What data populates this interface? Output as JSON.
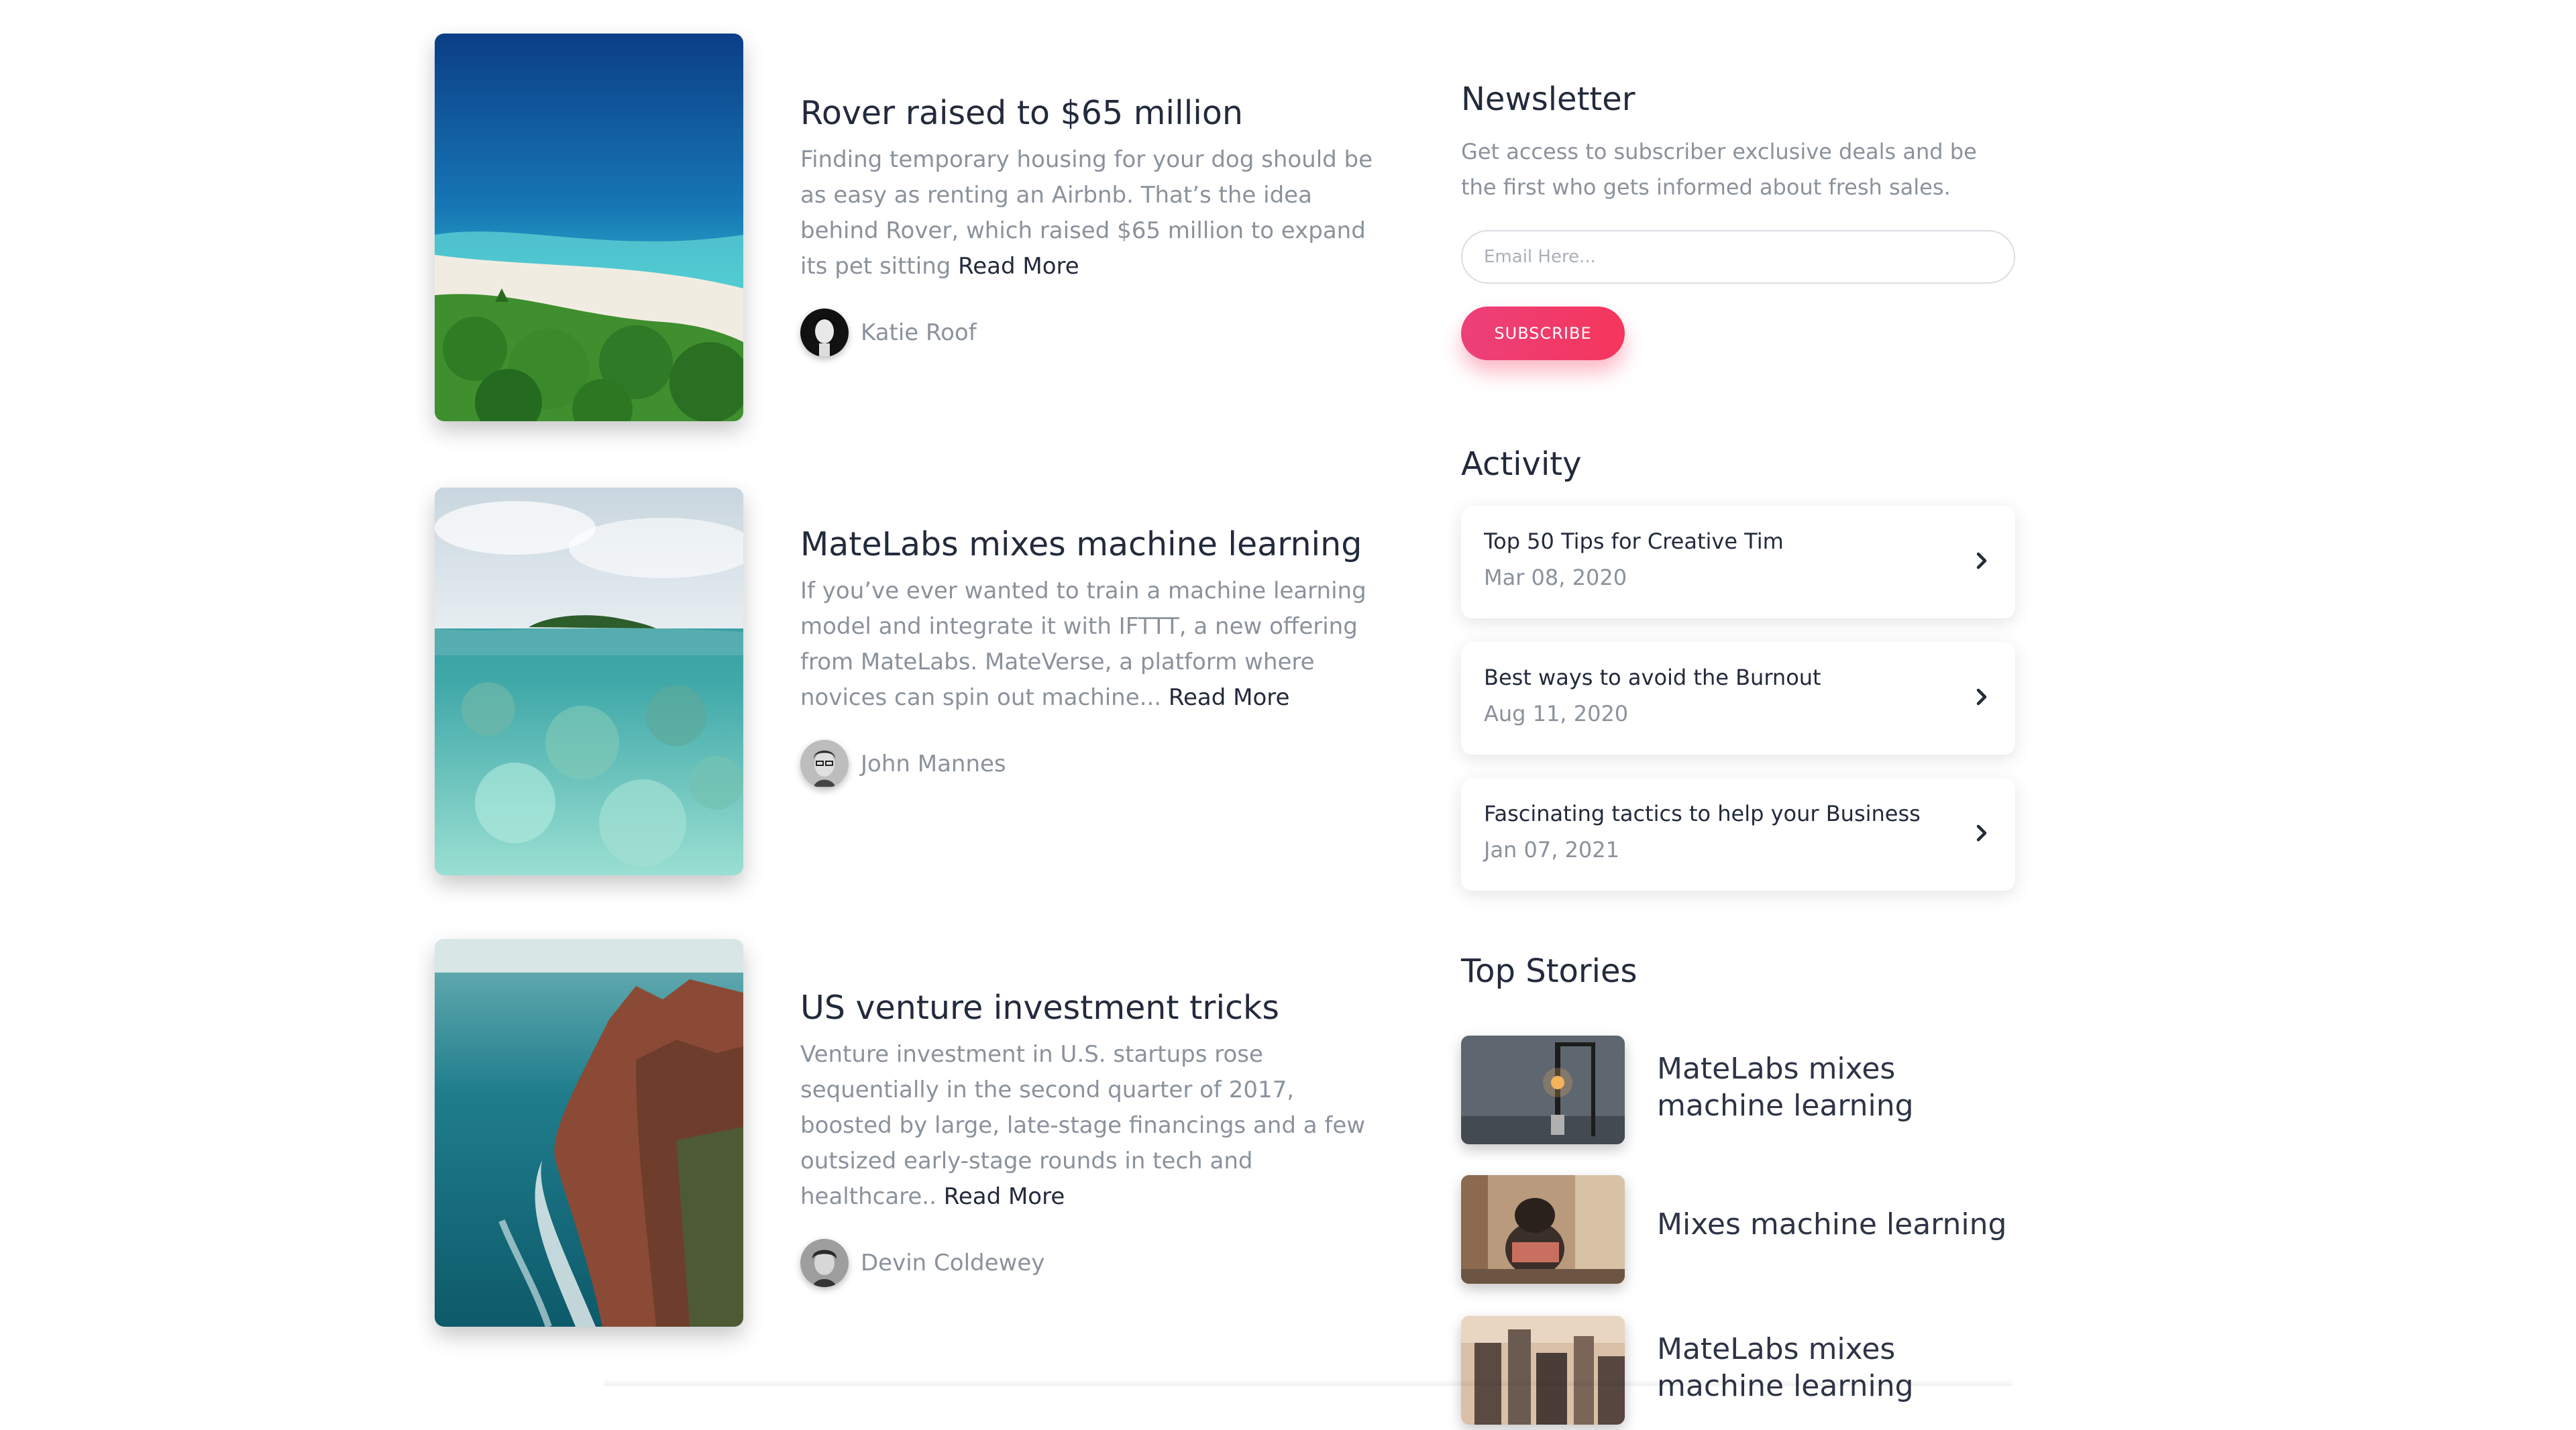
{
  "articles": [
    {
      "title": "Rover raised to $65 million",
      "excerpt": "Finding temporary housing for your dog should be as easy as renting an Airbnb. That’s the idea behind Rover, which raised $65 million to expand its pet sitting ",
      "read_more": "Read More",
      "author": "Katie Roof",
      "image": "aerial-beach-photo"
    },
    {
      "title": "MateLabs mixes machine learning",
      "excerpt": "If you’ve ever wanted to train a machine learning model and integrate it with IFTTT, a new offering from MateLabs. MateVerse, a platform where novices can spin out machine... ",
      "read_more": "Read More",
      "author": "John Mannes",
      "image": "underwater-island-photo"
    },
    {
      "title": "US venture investment tricks",
      "excerpt": "Venture investment in U.S. startups rose sequentially in the second quarter of 2017, boosted by large, late-stage financings and a few outsized early-stage rounds in tech and healthcare.. ",
      "read_more": "Read More",
      "author": "Devin Coldewey",
      "image": "sea-cliff-photo"
    }
  ],
  "newsletter": {
    "title": "Newsletter",
    "description": "Get access to subscriber exclusive deals and be the first who gets informed about fresh sales.",
    "email_placeholder": "Email Here...",
    "email_value": "",
    "subscribe_label": "SUBSCRIBE",
    "accent_color": "#f5365c"
  },
  "activity": {
    "title": "Activity",
    "items": [
      {
        "title": "Top 50 Tips for Creative Tim",
        "date": "Mar 08, 2020",
        "icon": "chevron-right-icon"
      },
      {
        "title": "Best ways to avoid the Burnout",
        "date": "Aug 11, 2020",
        "icon": "chevron-right-icon"
      },
      {
        "title": "Fascinating tactics to help your Business",
        "date": "Jan 07, 2021",
        "icon": "chevron-right-icon"
      }
    ]
  },
  "top_stories": {
    "title": "Top Stories",
    "items": [
      {
        "title": "MateLabs mixes machine learning",
        "image": "lamp-photo"
      },
      {
        "title": "Mixes machine learning",
        "image": "dog-photo"
      },
      {
        "title": "MateLabs mixes machine learning",
        "image": "city-photo"
      }
    ]
  }
}
